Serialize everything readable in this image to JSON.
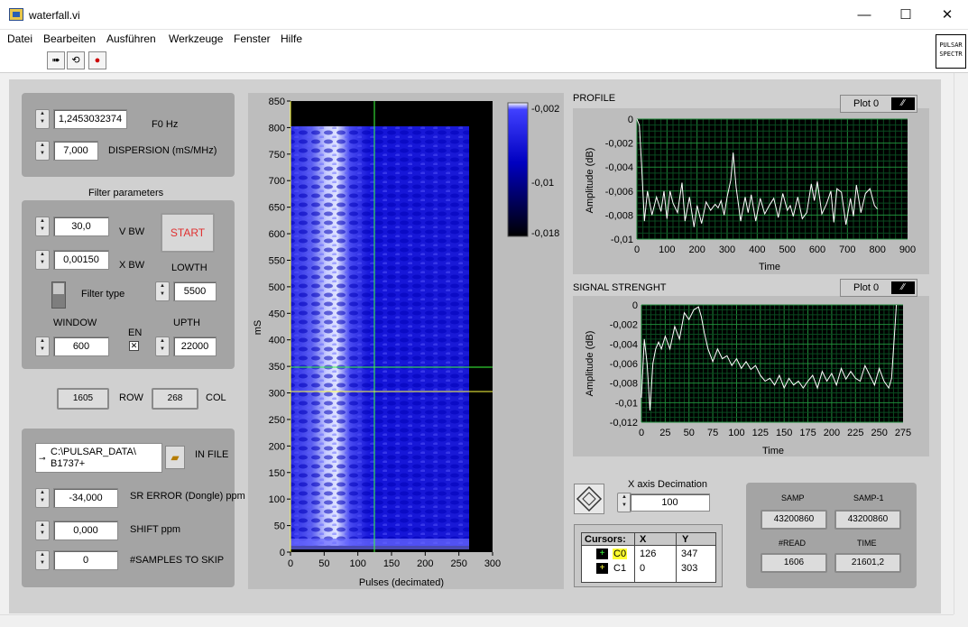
{
  "window": {
    "title": "waterfall.vi",
    "minimize": "—",
    "maximize": "☐",
    "close": "✕"
  },
  "menu": [
    "Datei",
    "Bearbeiten",
    "Ausführen",
    "Werkzeuge",
    "Fenster",
    "Hilfe"
  ],
  "toolbar": {
    "run": "➠",
    "run_continuous": "⟲",
    "abort": "●"
  },
  "vi_icon": {
    "line1": "PULSAR",
    "line2": "SPECTR"
  },
  "controls": {
    "f0": {
      "value": "1,2453032374",
      "label": "F0 Hz"
    },
    "dispersion": {
      "value": "7,000",
      "label": "DISPERSION (mS/MHz)"
    },
    "filter_title": "Filter parameters",
    "vbw": {
      "value": "30,0",
      "label": "V BW"
    },
    "xbw": {
      "value": "0,00150",
      "label": "X BW"
    },
    "start": "START",
    "lowth": {
      "label": "LOWTH",
      "value": "5500"
    },
    "filter_type": "Filter type",
    "window": {
      "label": "WINDOW",
      "value": "600"
    },
    "en": "EN",
    "upth": {
      "label": "UPTH",
      "value": "22000"
    },
    "row": {
      "value": "1605",
      "label": "ROW"
    },
    "col": {
      "value": "268",
      "label": "COL"
    },
    "infile": {
      "line1": "C:\\PULSAR_DATA\\",
      "line2": "B1737+",
      "label": "IN FILE"
    },
    "sr_error": {
      "value": "-34,000",
      "label": "SR ERROR (Dongle) ppm"
    },
    "shift": {
      "value": "0,000",
      "label": "SHIFT ppm"
    },
    "skip": {
      "value": "0",
      "label": "#SAMPLES TO SKIP"
    }
  },
  "waterfall": {
    "x_label": "Pulses (decimated)",
    "y_label": "mS",
    "x_ticks": [
      "0",
      "50",
      "100",
      "150",
      "200",
      "250",
      "300"
    ],
    "y_ticks": [
      "0",
      "50",
      "100",
      "150",
      "200",
      "250",
      "300",
      "350",
      "400",
      "450",
      "500",
      "550",
      "600",
      "650",
      "700",
      "750",
      "800",
      "850"
    ],
    "colorbar": [
      "-0,002",
      "-0,01",
      "-0,018"
    ]
  },
  "profile": {
    "title": "PROFILE",
    "legend": "Plot 0",
    "x_label": "Time",
    "y_label": "Amplitude (dB)",
    "x_ticks": [
      "0",
      "100",
      "200",
      "300",
      "400",
      "500",
      "600",
      "700",
      "800",
      "900"
    ],
    "y_ticks": [
      "0",
      "-0,002",
      "-0,004",
      "-0,006",
      "-0,008",
      "-0,01"
    ]
  },
  "signal": {
    "title": "SIGNAL STRENGHT",
    "legend": "Plot 0",
    "x_label": "Time",
    "y_label": "Amplitude (dB)",
    "x_ticks": [
      "0",
      "25",
      "50",
      "75",
      "100",
      "125",
      "150",
      "175",
      "200",
      "225",
      "250",
      "275"
    ],
    "y_ticks": [
      "0",
      "-0,002",
      "-0,004",
      "-0,006",
      "-0,008",
      "-0,01",
      "-0,012"
    ]
  },
  "decimation": {
    "label": "X axis Decimation",
    "value": "100"
  },
  "cursors": {
    "headers": [
      "Cursors:",
      "X",
      "Y"
    ],
    "rows": [
      {
        "name": "C0",
        "x": "126",
        "y": "347"
      },
      {
        "name": "C1",
        "x": "0",
        "y": "303"
      }
    ]
  },
  "status": {
    "samp_label": "SAMP",
    "samp": "43200860",
    "samp1_label": "SAMP-1",
    "samp1": "43200860",
    "read_label": "#READ",
    "read": "1606",
    "time_label": "TIME",
    "time": "21601,2"
  },
  "chart_data": [
    {
      "type": "line",
      "title": "PROFILE",
      "xlabel": "Time",
      "ylabel": "Amplitude (dB)",
      "xlim": [
        0,
        900
      ],
      "ylim": [
        -0.01,
        0
      ],
      "series": [
        {
          "name": "Plot 0",
          "x": [
            0,
            8,
            16,
            25,
            35,
            50,
            65,
            80,
            90,
            100,
            110,
            120,
            135,
            150,
            160,
            175,
            190,
            200,
            215,
            230,
            245,
            260,
            270,
            280,
            290,
            300,
            312,
            320,
            330,
            345,
            360,
            370,
            380,
            395,
            410,
            425,
            440,
            455,
            470,
            485,
            500,
            510,
            520,
            535,
            550,
            565,
            580,
            590,
            600,
            615,
            630,
            645,
            655,
            665,
            680,
            695,
            710,
            720,
            730,
            745,
            760,
            775,
            790,
            800
          ],
          "y": [
            0,
            -0.0005,
            -0.004,
            -0.0085,
            -0.006,
            -0.008,
            -0.0065,
            -0.0077,
            -0.006,
            -0.0083,
            -0.006,
            -0.007,
            -0.0078,
            -0.0053,
            -0.0085,
            -0.0065,
            -0.009,
            -0.0072,
            -0.0087,
            -0.0069,
            -0.0076,
            -0.0071,
            -0.0074,
            -0.0068,
            -0.008,
            -0.0065,
            -0.0051,
            -0.0028,
            -0.0057,
            -0.0085,
            -0.0065,
            -0.0078,
            -0.0063,
            -0.0085,
            -0.0066,
            -0.0079,
            -0.0072,
            -0.0066,
            -0.0082,
            -0.0062,
            -0.0076,
            -0.0072,
            -0.0081,
            -0.0065,
            -0.0083,
            -0.0078,
            -0.0054,
            -0.0068,
            -0.0052,
            -0.0079,
            -0.0071,
            -0.006,
            -0.0086,
            -0.0058,
            -0.0061,
            -0.0088,
            -0.0066,
            -0.0081,
            -0.0055,
            -0.0078,
            -0.0062,
            -0.0058,
            -0.0072,
            -0.0075
          ]
        }
      ]
    },
    {
      "type": "line",
      "title": "SIGNAL STRENGHT",
      "xlabel": "Time",
      "ylabel": "Amplitude (dB)",
      "xlim": [
        0,
        275
      ],
      "ylim": [
        -0.012,
        0
      ],
      "series": [
        {
          "name": "Plot 0",
          "x": [
            0,
            3,
            6,
            9,
            12,
            15,
            18,
            21,
            25,
            30,
            35,
            40,
            45,
            50,
            55,
            60,
            63,
            66,
            70,
            75,
            80,
            85,
            90,
            95,
            100,
            105,
            110,
            115,
            120,
            125,
            130,
            135,
            140,
            145,
            150,
            155,
            160,
            165,
            170,
            175,
            180,
            185,
            190,
            195,
            200,
            205,
            210,
            215,
            220,
            225,
            230,
            235,
            240,
            245,
            250,
            255,
            260,
            263,
            266,
            268
          ],
          "y": [
            -0.0095,
            -0.0035,
            -0.006,
            -0.0108,
            -0.006,
            -0.0045,
            -0.0038,
            -0.0045,
            -0.0032,
            -0.0045,
            -0.0022,
            -0.0035,
            -0.0008,
            -0.0015,
            -0.0005,
            -0.0002,
            -0.0012,
            -0.0028,
            -0.0045,
            -0.0058,
            -0.0045,
            -0.0055,
            -0.0052,
            -0.0062,
            -0.0055,
            -0.0065,
            -0.0058,
            -0.0066,
            -0.0062,
            -0.0072,
            -0.0078,
            -0.0075,
            -0.0082,
            -0.0072,
            -0.0085,
            -0.0075,
            -0.0082,
            -0.0078,
            -0.0085,
            -0.0078,
            -0.0072,
            -0.0085,
            -0.0068,
            -0.0078,
            -0.007,
            -0.0082,
            -0.0065,
            -0.0076,
            -0.0068,
            -0.0075,
            -0.0078,
            -0.0062,
            -0.0072,
            -0.0082,
            -0.0065,
            -0.0078,
            -0.0085,
            -0.0075,
            -0.003,
            0
          ]
        }
      ]
    }
  ]
}
